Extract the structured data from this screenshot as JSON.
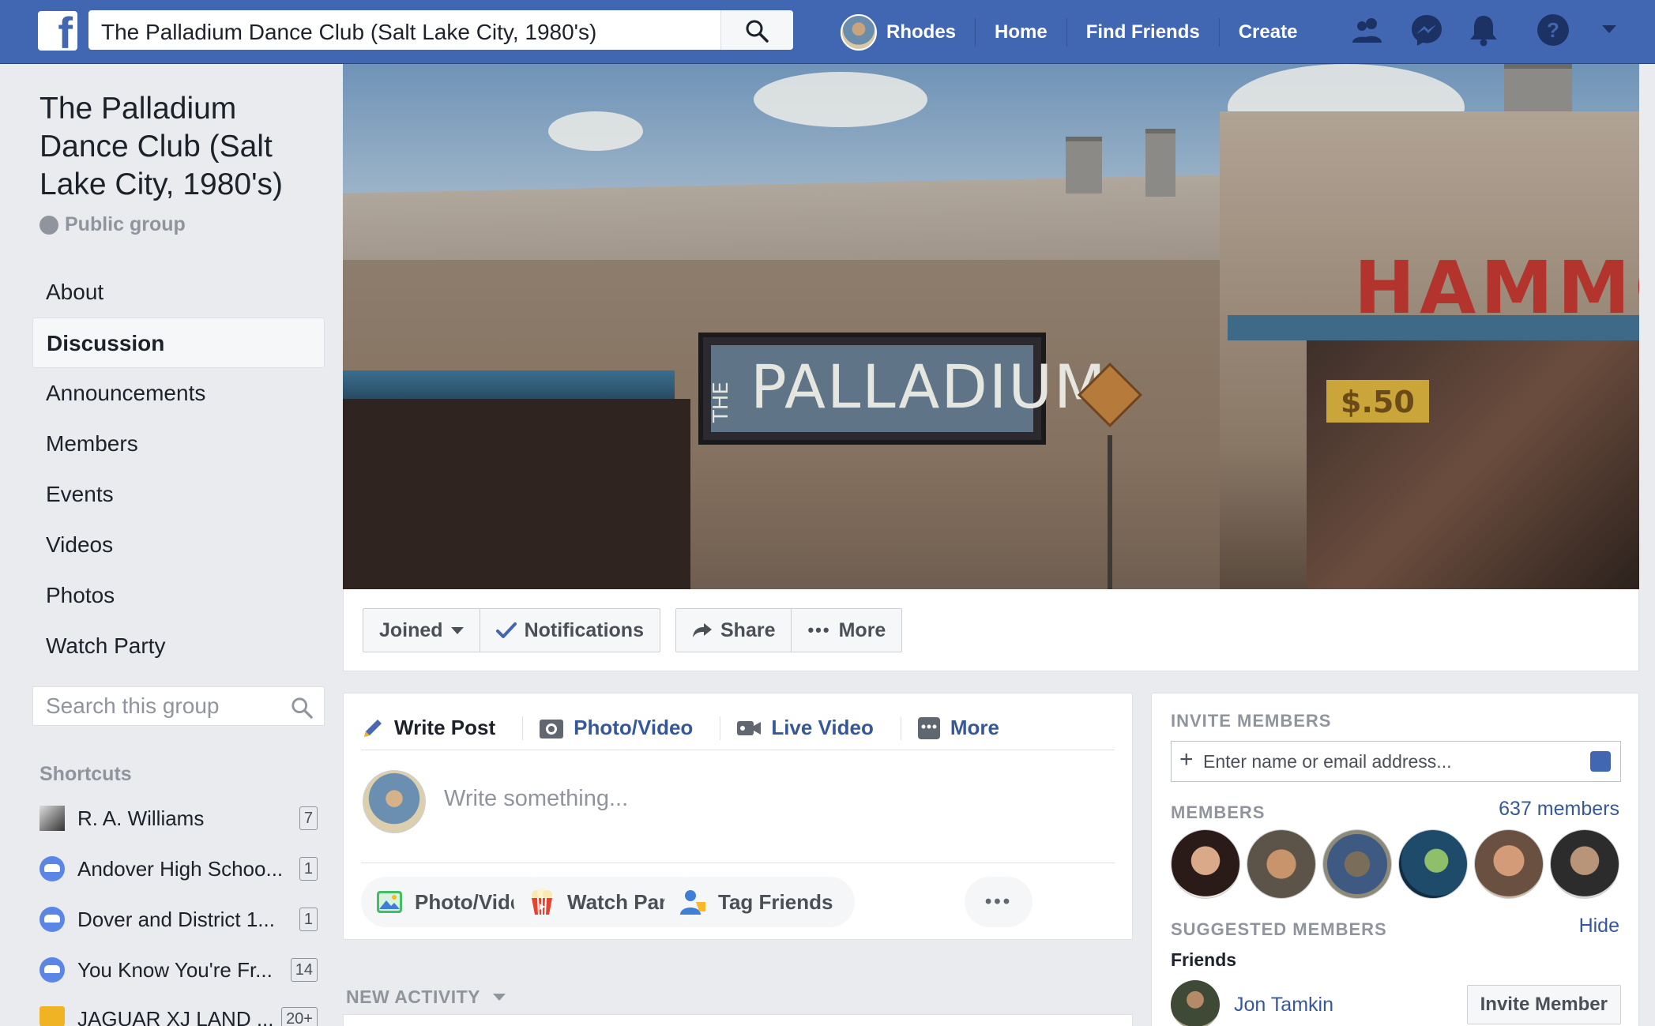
{
  "topbar": {
    "search_value": "The Palladium Dance Club (Salt Lake City, 1980's)",
    "user_name": "Rhodes",
    "links": [
      "Home",
      "Find Friends",
      "Create"
    ],
    "icons": [
      "friends-icon",
      "messenger-icon",
      "notifications-icon",
      "help-icon",
      "account-menu-icon"
    ],
    "brand_color": "#4267b2"
  },
  "group": {
    "title": "The Palladium Dance Club (Salt Lake City, 1980's)",
    "privacy": "Public group",
    "nav": [
      "About",
      "Discussion",
      "Announcements",
      "Members",
      "Events",
      "Videos",
      "Photos",
      "Watch Party"
    ],
    "active_nav": "Discussion",
    "search_placeholder": "Search this group"
  },
  "shortcuts": {
    "heading": "Shortcuts",
    "items": [
      {
        "name": "R. A. Williams",
        "count": "7",
        "icon": "photo"
      },
      {
        "name": "Andover High Schoo...",
        "count": "1",
        "icon": "group"
      },
      {
        "name": "Dover and District 1...",
        "count": "1",
        "icon": "group"
      },
      {
        "name": "You Know You're Fr...",
        "count": "14",
        "icon": "group"
      },
      {
        "name": "JAGUAR XJ LAND ...",
        "count": "20+",
        "icon": "trophy"
      }
    ]
  },
  "cover": {
    "sign_text": "PALLADIUM",
    "sign_prefix": "THE",
    "store_text": "HAMMO",
    "price_text": "$.50"
  },
  "actions": {
    "joined": "Joined",
    "notifications": "Notifications",
    "share": "Share",
    "more": "More"
  },
  "composer": {
    "tabs": [
      "Write Post",
      "Photo/Video",
      "Live Video",
      "More"
    ],
    "placeholder": "Write something...",
    "pills": [
      "Photo/Video",
      "Watch Party",
      "Tag Friends"
    ]
  },
  "feed": {
    "new_activity": "NEW ACTIVITY"
  },
  "invite": {
    "heading": "INVITE MEMBERS",
    "placeholder": "Enter name or email address...",
    "members_heading": "MEMBERS",
    "members_count": "637 members",
    "suggested_heading": "SUGGESTED MEMBERS",
    "hide": "Hide",
    "friends_label": "Friends",
    "suggested_name": "Jon Tamkin",
    "invite_button": "Invite Member"
  }
}
